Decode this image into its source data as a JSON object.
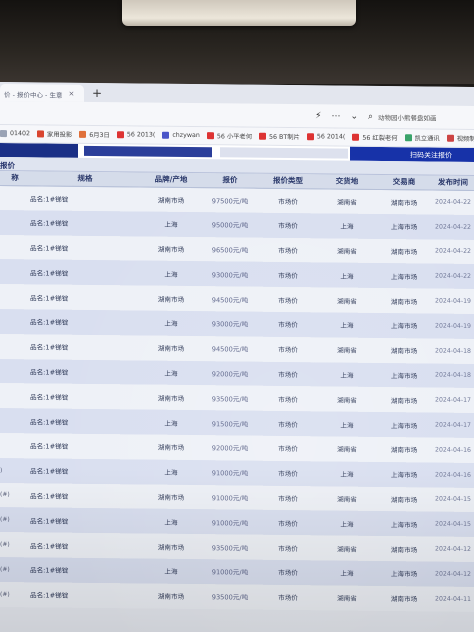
{
  "browser": {
    "tab_title": "价 - 报价中心 - 生意",
    "tab_close": "×",
    "new_tab": "+",
    "search_placeholder": "动物园小熊餐盘如画"
  },
  "toolbar_icons": [
    "lightning-icon",
    "more-icon",
    "chevron-down-icon",
    "search-icon"
  ],
  "bookmarks": [
    {
      "label": "01402",
      "color": "#9aa3b5"
    },
    {
      "label": "家用投影",
      "color": "#d9452f"
    },
    {
      "label": "6月3日",
      "color": "#e0703a"
    },
    {
      "label": "56 2013(",
      "color": "#d33"
    },
    {
      "label": "chzywan",
      "color": "#4a55c8"
    },
    {
      "label": "56 小平老何",
      "color": "#d33"
    },
    {
      "label": "56 BT制片",
      "color": "#d33"
    },
    {
      "label": "56 2014(",
      "color": "#d33"
    },
    {
      "label": "56 红裂老何",
      "color": "#d33"
    },
    {
      "label": "凯立通讯",
      "color": "#3aa36a"
    },
    {
      "label": "视频制作",
      "color": "#c44"
    }
  ],
  "banner": {
    "right_text": "扫码关注报价"
  },
  "section_title": "报价",
  "table": {
    "headers": [
      "称",
      "规格",
      "品牌/产地",
      "报价",
      "报价类型",
      "交货地",
      "交易商",
      "发布时间"
    ],
    "rows": [
      {
        "name": "",
        "spec": "品名:1#锑锭",
        "brand": "湖南市场",
        "price": "97500元/吨",
        "type": "市场价",
        "delivery": "湖南省",
        "dealer": "湖南市场",
        "date": "2024-04-22"
      },
      {
        "name": "",
        "spec": "品名:1#锑锭",
        "brand": "上海",
        "price": "95000元/吨",
        "type": "市场价",
        "delivery": "上海",
        "dealer": "上海市场",
        "date": "2024-04-22"
      },
      {
        "name": "",
        "spec": "品名:1#锑锭",
        "brand": "湖南市场",
        "price": "96500元/吨",
        "type": "市场价",
        "delivery": "湖南省",
        "dealer": "湖南市场",
        "date": "2024-04-22"
      },
      {
        "name": "",
        "spec": "品名:1#锑锭",
        "brand": "上海",
        "price": "93000元/吨",
        "type": "市场价",
        "delivery": "上海",
        "dealer": "上海市场",
        "date": "2024-04-22"
      },
      {
        "name": "",
        "spec": "品名:1#锑锭",
        "brand": "湖南市场",
        "price": "94500元/吨",
        "type": "市场价",
        "delivery": "湖南省",
        "dealer": "湖南市场",
        "date": "2024-04-19"
      },
      {
        "name": "",
        "spec": "品名:1#锑锭",
        "brand": "上海",
        "price": "93000元/吨",
        "type": "市场价",
        "delivery": "上海",
        "dealer": "上海市场",
        "date": "2024-04-19"
      },
      {
        "name": "",
        "spec": "品名:1#锑锭",
        "brand": "湖南市场",
        "price": "94500元/吨",
        "type": "市场价",
        "delivery": "湖南省",
        "dealer": "湖南市场",
        "date": "2024-04-18"
      },
      {
        "name": "",
        "spec": "品名:1#锑锭",
        "brand": "上海",
        "price": "92000元/吨",
        "type": "市场价",
        "delivery": "上海",
        "dealer": "上海市场",
        "date": "2024-04-18"
      },
      {
        "name": "",
        "spec": "品名:1#锑锭",
        "brand": "湖南市场",
        "price": "93500元/吨",
        "type": "市场价",
        "delivery": "湖南省",
        "dealer": "湖南市场",
        "date": "2024-04-17"
      },
      {
        "name": "",
        "spec": "品名:1#锑锭",
        "brand": "上海",
        "price": "91500元/吨",
        "type": "市场价",
        "delivery": "上海",
        "dealer": "上海市场",
        "date": "2024-04-17"
      },
      {
        "name": "",
        "spec": "品名:1#锑锭",
        "brand": "湖南市场",
        "price": "92000元/吨",
        "type": "市场价",
        "delivery": "湖南省",
        "dealer": "湖南市场",
        "date": "2024-04-16"
      },
      {
        "name": ")",
        "spec": "品名:1#锑锭",
        "brand": "上海",
        "price": "91000元/吨",
        "type": "市场价",
        "delivery": "上海",
        "dealer": "上海市场",
        "date": "2024-04-16"
      },
      {
        "name": "(#)",
        "spec": "品名:1#锑锭",
        "brand": "湖南市场",
        "price": "91000元/吨",
        "type": "市场价",
        "delivery": "湖南省",
        "dealer": "湖南市场",
        "date": "2024-04-15"
      },
      {
        "name": "(#)",
        "spec": "品名:1#锑锭",
        "brand": "上海",
        "price": "91000元/吨",
        "type": "市场价",
        "delivery": "上海",
        "dealer": "上海市场",
        "date": "2024-04-15"
      },
      {
        "name": "(#)",
        "spec": "品名:1#锑锭",
        "brand": "湖南市场",
        "price": "93500元/吨",
        "type": "市场价",
        "delivery": "湖南省",
        "dealer": "湖南市场",
        "date": "2024-04-12"
      },
      {
        "name": "(#)",
        "spec": "品名:1#锑锭",
        "brand": "上海",
        "price": "91000元/吨",
        "type": "市场价",
        "delivery": "上海",
        "dealer": "上海市场",
        "date": "2024-04-12"
      },
      {
        "name": "(#)",
        "spec": "品名:1#锑锭",
        "brand": "湖南市场",
        "price": "93500元/吨",
        "type": "市场价",
        "delivery": "湖南省",
        "dealer": "湖南市场",
        "date": "2024-04-11"
      }
    ]
  }
}
